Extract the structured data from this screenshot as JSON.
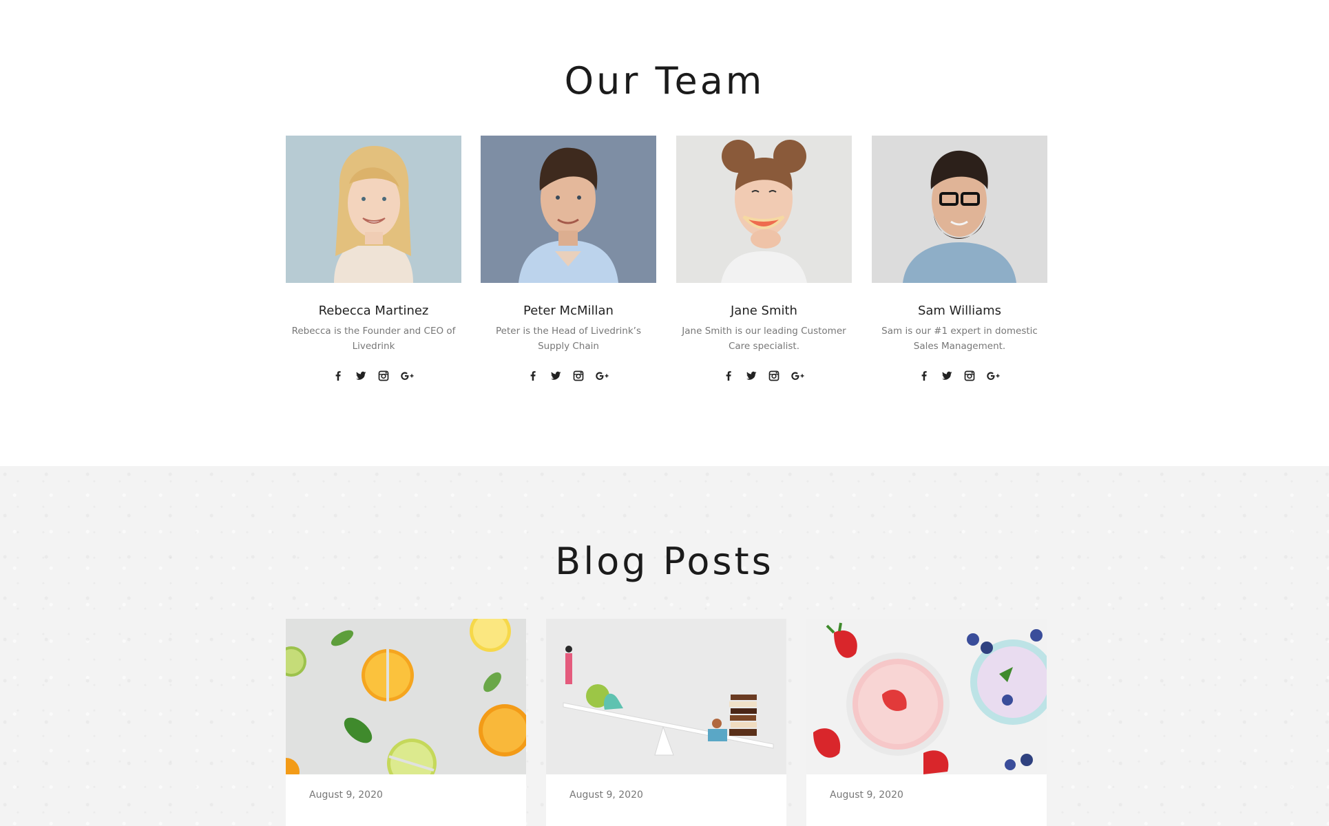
{
  "team": {
    "title": "Our Team",
    "members": [
      {
        "name": "Rebecca Martinez",
        "bio": "Rebecca is the Founder and CEO of Livedrink"
      },
      {
        "name": "Peter McMillan",
        "bio": "Peter is the Head of Livedrink’s Supply Chain"
      },
      {
        "name": "Jane Smith",
        "bio": "Jane Smith is our leading Customer Care specialist."
      },
      {
        "name": "Sam Williams",
        "bio": "Sam is our #1 expert in domestic Sales Management."
      }
    ],
    "social_icons": [
      "facebook-icon",
      "twitter-icon",
      "instagram-icon",
      "google-plus-icon"
    ]
  },
  "blog": {
    "title": "Blog Posts",
    "posts": [
      {
        "date": "August 9, 2020",
        "image": "citrus-slices-image"
      },
      {
        "date": "August 9, 2020",
        "image": "seesaw-balance-image"
      },
      {
        "date": "August 9, 2020",
        "image": "strawberry-smoothie-image"
      }
    ]
  },
  "colors": {
    "text_dark": "#1b1b1b",
    "text_muted": "#777777",
    "blog_background": "#f3f3f3"
  }
}
